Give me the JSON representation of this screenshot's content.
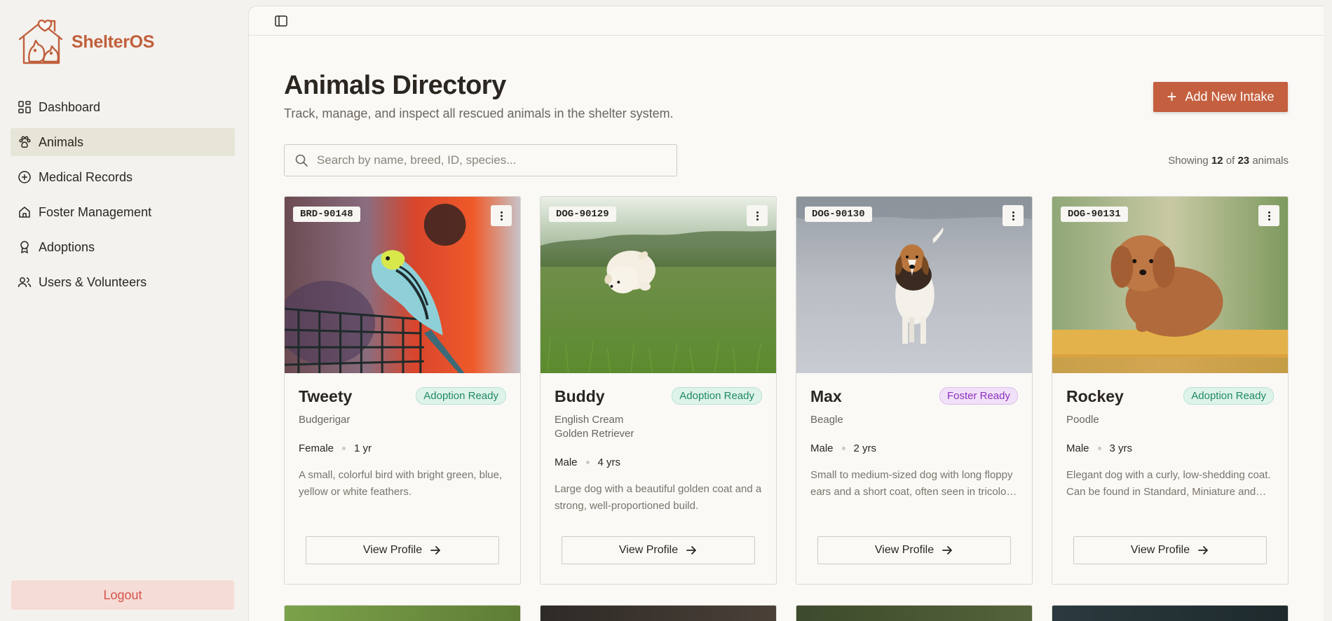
{
  "app": {
    "name": "ShelterOS",
    "brand_color": "#c0603c"
  },
  "sidebar": {
    "items": [
      {
        "label": "Dashboard",
        "icon": "dashboard-icon",
        "active": false
      },
      {
        "label": "Animals",
        "icon": "paw-icon",
        "active": true
      },
      {
        "label": "Medical Records",
        "icon": "plus-circle-icon",
        "active": false
      },
      {
        "label": "Foster Management",
        "icon": "home-icon",
        "active": false
      },
      {
        "label": "Adoptions",
        "icon": "award-icon",
        "active": false
      },
      {
        "label": "Users & Volunteers",
        "icon": "users-icon",
        "active": false
      }
    ],
    "logout_label": "Logout"
  },
  "header": {
    "title": "Animals Directory",
    "subtitle": "Track, manage, and inspect all rescued animals in the shelter system.",
    "add_button_label": "Add New Intake"
  },
  "search": {
    "placeholder": "Search by name, breed, ID, species..."
  },
  "count": {
    "prefix": "Showing",
    "shown": "12",
    "of": "of",
    "total": "23",
    "suffix": "animals"
  },
  "cards": [
    {
      "id": "BRD-90148",
      "name": "Tweety",
      "status": "Adoption Ready",
      "breed": "Budgerigar",
      "sex": "Female",
      "age": "1 yr",
      "description": "A small, colorful bird with bright green, blue, yellow or white feathers.",
      "button": "View Profile"
    },
    {
      "id": "DOG-90129",
      "name": "Buddy",
      "status": "Adoption Ready",
      "breed": "English Cream Golden Retriever",
      "sex": "Male",
      "age": "4 yrs",
      "description": "Large dog with a beautiful golden coat and a strong, well-proportioned build.",
      "button": "View Profile"
    },
    {
      "id": "DOG-90130",
      "name": "Max",
      "status": "Foster Ready",
      "breed": "Beagle",
      "sex": "Male",
      "age": "2 yrs",
      "description": "Small to medium-sized dog with long floppy ears and a short coat, often seen in tricolor patterns.",
      "button": "View Profile"
    },
    {
      "id": "DOG-90131",
      "name": "Rockey",
      "status": "Adoption Ready",
      "breed": "Poodle",
      "sex": "Male",
      "age": "3 yrs",
      "description": "Elegant dog with a curly, low-shedding coat. Can be found in Standard, Miniature and Toy sizes.",
      "button": "View Profile"
    }
  ],
  "colors": {
    "adoption_ready": "#1f8a5f",
    "foster_ready": "#8f2fc0",
    "accent_button": "#c4603f",
    "logout": "#d6534c"
  }
}
